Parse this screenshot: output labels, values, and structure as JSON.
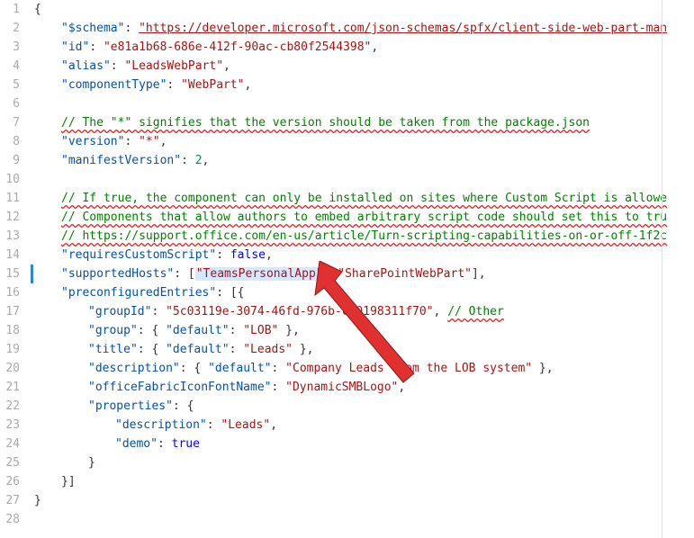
{
  "line_numbers": [
    "1",
    "2",
    "3",
    "4",
    "5",
    "6",
    "7",
    "8",
    "9",
    "10",
    "11",
    "12",
    "13",
    "14",
    "15",
    "16",
    "17",
    "18",
    "19",
    "20",
    "21",
    "22",
    "23",
    "24",
    "25",
    "26",
    "27",
    "28"
  ],
  "l1": "{",
  "l2": {
    "key": "\"$schema\"",
    "colon": ": ",
    "val": "\"https://developer.microsoft.com/json-schemas/spfx/client-side-web-part-man"
  },
  "l3": {
    "key": "\"id\"",
    "colon": ": ",
    "val": "\"e81a1b68-686e-412f-90ac-cb80f2544398\"",
    "end": ","
  },
  "l4": {
    "key": "\"alias\"",
    "colon": ": ",
    "val": "\"LeadsWebPart\"",
    "end": ","
  },
  "l5": {
    "key": "\"componentType\"",
    "colon": ": ",
    "val": "\"WebPart\"",
    "end": ","
  },
  "l7": {
    "comment": "// The \"*\" signifies that the version should be taken from the package.json"
  },
  "l8": {
    "key": "\"version\"",
    "colon": ": ",
    "val": "\"*\"",
    "end": ","
  },
  "l9": {
    "key": "\"manifestVersion\"",
    "colon": ": ",
    "val": "2",
    "end": ","
  },
  "l11": {
    "comment": "// If true, the component can only be installed on sites where Custom Script is allowe"
  },
  "l12": {
    "comment": "// Components that allow authors to embed arbitrary script code should set this to tru"
  },
  "l13": {
    "comment": "// https://support.office.com/en-us/article/Turn-scripting-capabilities-on-or-off-1f2c"
  },
  "l14": {
    "key": "\"requiresCustomScript\"",
    "colon": ": ",
    "val": "false",
    "end": ","
  },
  "l15": {
    "key": "\"supportedHosts\"",
    "colon": ": [",
    "v1": "\"TeamsPersonalApp\"",
    "sep": ", ",
    "v2": "\"SharePointWebPart\"",
    "close": "],"
  },
  "l16": {
    "key": "\"preconfiguredEntries\"",
    "colon": ": [{"
  },
  "l17": {
    "key": "\"groupId\"",
    "colon": ": ",
    "val": "\"5c03119e-3074-46fd-976b-c60198311f70\"",
    "end": ", ",
    "comment": "// Other"
  },
  "l18": {
    "key": "\"group\"",
    "colon": ": { ",
    "dkey": "\"default\"",
    "dcolon": ": ",
    "dval": "\"LOB\"",
    "close": " },"
  },
  "l19": {
    "key": "\"title\"",
    "colon": ": { ",
    "dkey": "\"default\"",
    "dcolon": ": ",
    "dval": "\"Leads\"",
    "close": " },"
  },
  "l20": {
    "key": "\"description\"",
    "colon": ": { ",
    "dkey": "\"default\"",
    "dcolon": ": ",
    "dval": "\"Company Leads from the LOB system\"",
    "close": " },"
  },
  "l21": {
    "key": "\"officeFabricIconFontName\"",
    "colon": ": ",
    "val": "\"DynamicSMBLogo\"",
    "end": ","
  },
  "l22": {
    "key": "\"properties\"",
    "colon": ": {"
  },
  "l23": {
    "key": "\"description\"",
    "colon": ": ",
    "val": "\"Leads\"",
    "end": ","
  },
  "l24": {
    "key": "\"demo\"",
    "colon": ": ",
    "val": "true"
  },
  "l25": {
    "close": "}"
  },
  "l26": {
    "close": "}]"
  },
  "l27": {
    "close": "}"
  }
}
